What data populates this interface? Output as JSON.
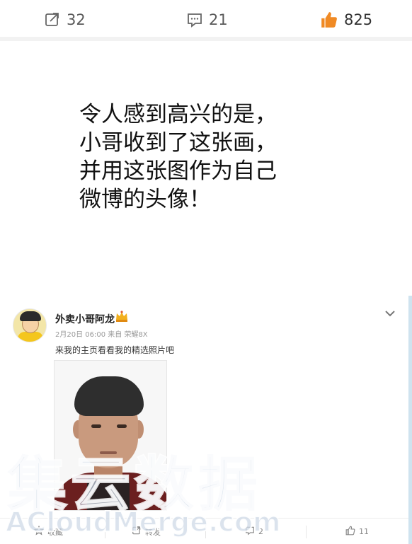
{
  "top_bar": {
    "repost_count": "32",
    "comment_count": "21",
    "like_count": "825",
    "icons": {
      "repost": "repost-icon",
      "comment": "comment-icon",
      "like": "thumbs-up-icon"
    },
    "like_color": "#f08a24"
  },
  "caption": {
    "lines": [
      "令人感到高兴的是，",
      "小哥收到了这张画，",
      "并用这张图作为自己",
      "微博的头像！"
    ]
  },
  "embedded_post": {
    "username": "外卖小哥阿龙",
    "meta": "2月20日 06:00 来自 荣耀8X",
    "text": "来我的主页看看我的精选照片吧",
    "actions": {
      "favorite_label": "收藏",
      "share_label": "转发",
      "comment_count": "2",
      "like_count": "11"
    }
  },
  "watermark": {
    "big": "集云数据",
    "latin": "ACloudMerge.com"
  }
}
